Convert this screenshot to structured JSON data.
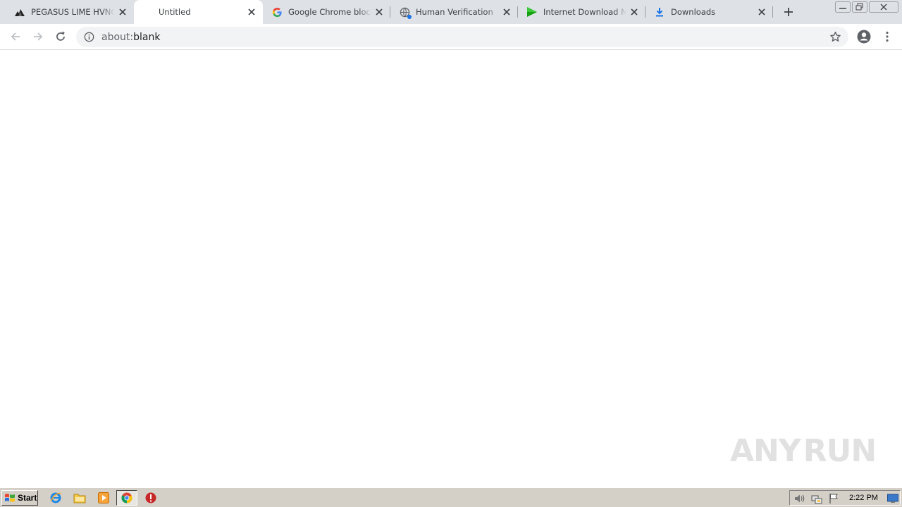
{
  "tabs": [
    {
      "title": "PEGASUS LIME HVNC.exe",
      "icon": "pegasus-icon",
      "active": false
    },
    {
      "title": "Untitled",
      "icon": "none",
      "active": true
    },
    {
      "title": "Google Chrome blocks some downloads",
      "icon": "google-g-icon",
      "active": false
    },
    {
      "title": "Human Verification",
      "icon": "globe-icon",
      "active": false
    },
    {
      "title": "Internet Download Manager",
      "icon": "green-play-icon",
      "active": false
    },
    {
      "title": "Downloads",
      "icon": "download-icon",
      "active": false
    }
  ],
  "toolbar": {
    "url_scheme": "about:",
    "url_path": "blank"
  },
  "watermark": {
    "left": "ANY",
    "right": "RUN"
  },
  "taskbar": {
    "start_label": "Start",
    "clock": "2:22 PM"
  },
  "colors": {
    "tabstrip": "#dee1e6",
    "omnibox": "#f1f3f4",
    "taskbar": "#d4d0c8"
  }
}
